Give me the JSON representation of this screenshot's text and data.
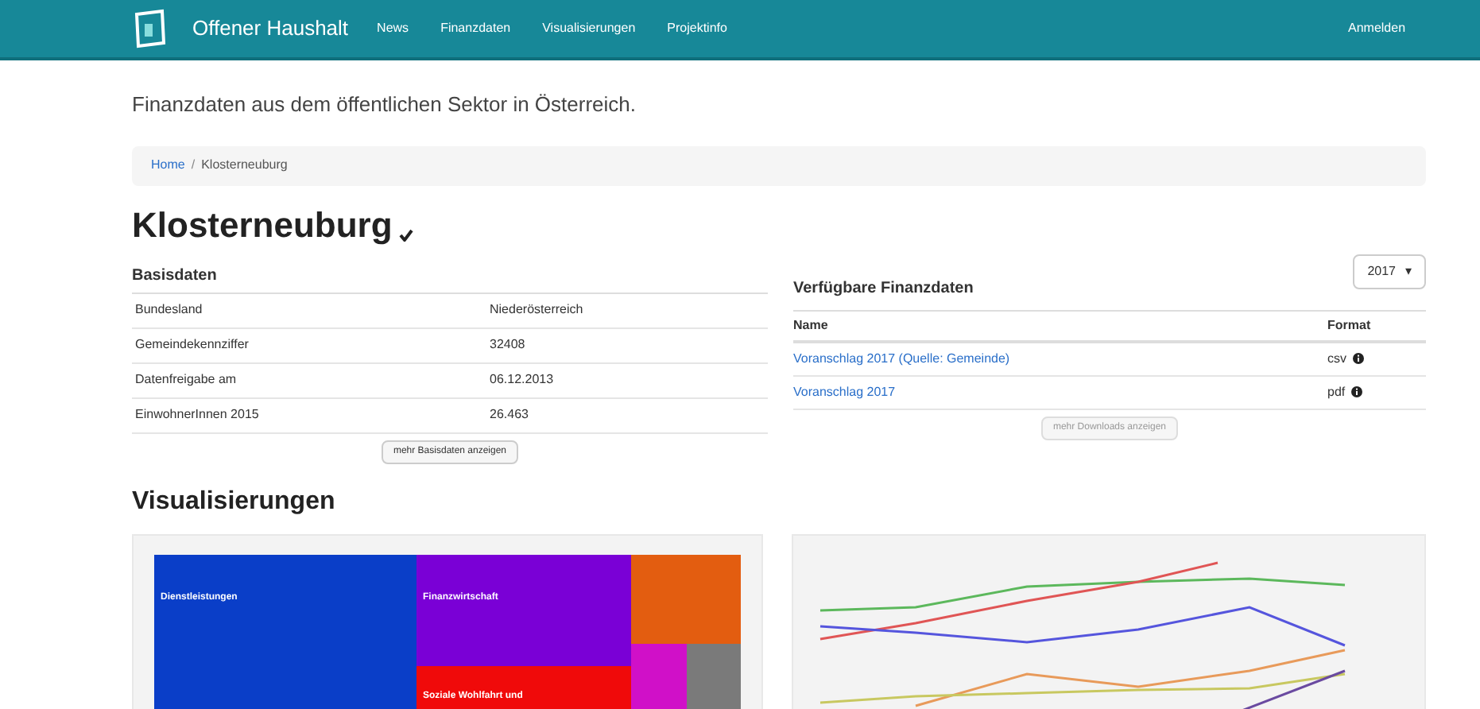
{
  "navbar": {
    "brand": "Offener Haushalt",
    "links": [
      "News",
      "Finanzdaten",
      "Visualisierungen",
      "Projektinfo"
    ],
    "login": "Anmelden"
  },
  "tagline": "Finanzdaten aus dem öffentlichen Sektor in Österreich.",
  "breadcrumb": {
    "separator": "/",
    "items": [
      {
        "label": "Home",
        "link": true
      },
      {
        "label": "Klosterneuburg",
        "link": false
      }
    ]
  },
  "title": "Klosterneuburg",
  "basisdaten": {
    "heading": "Basisdaten",
    "rows": [
      {
        "label": "Bundesland",
        "value": "Niederösterreich"
      },
      {
        "label": "Gemeindekennziffer",
        "value": "32408"
      },
      {
        "label": "Datenfreigabe am",
        "value": "06.12.2013"
      },
      {
        "label": "EinwohnerInnen 2015",
        "value": "26.463"
      }
    ],
    "button": "mehr Basisdaten anzeigen"
  },
  "finanzdaten": {
    "heading": "Verfügbare Finanzdaten",
    "year": "2017",
    "caret": "▾",
    "columns": [
      "Name",
      "Format"
    ],
    "rows": [
      {
        "name": "Voranschlag 2017 (Quelle: Gemeinde)",
        "format": "csv"
      },
      {
        "name": "Voranschlag 2017",
        "format": "pdf"
      }
    ],
    "button": "mehr Downloads anzeigen"
  },
  "visualisierungen": {
    "heading": "Visualisierungen",
    "treemap": [
      {
        "label": "Dienstleistungen",
        "color": "#0a3ec8"
      },
      {
        "label": "Finanzwirtschaft",
        "color": "#7a00d6"
      },
      {
        "label": "Soziale Wohlfahrt und",
        "color": "#f00a0a"
      },
      {
        "color": "#e35d10"
      },
      {
        "color": "#d010c8"
      },
      {
        "color": "#7a7a7a"
      }
    ]
  }
}
